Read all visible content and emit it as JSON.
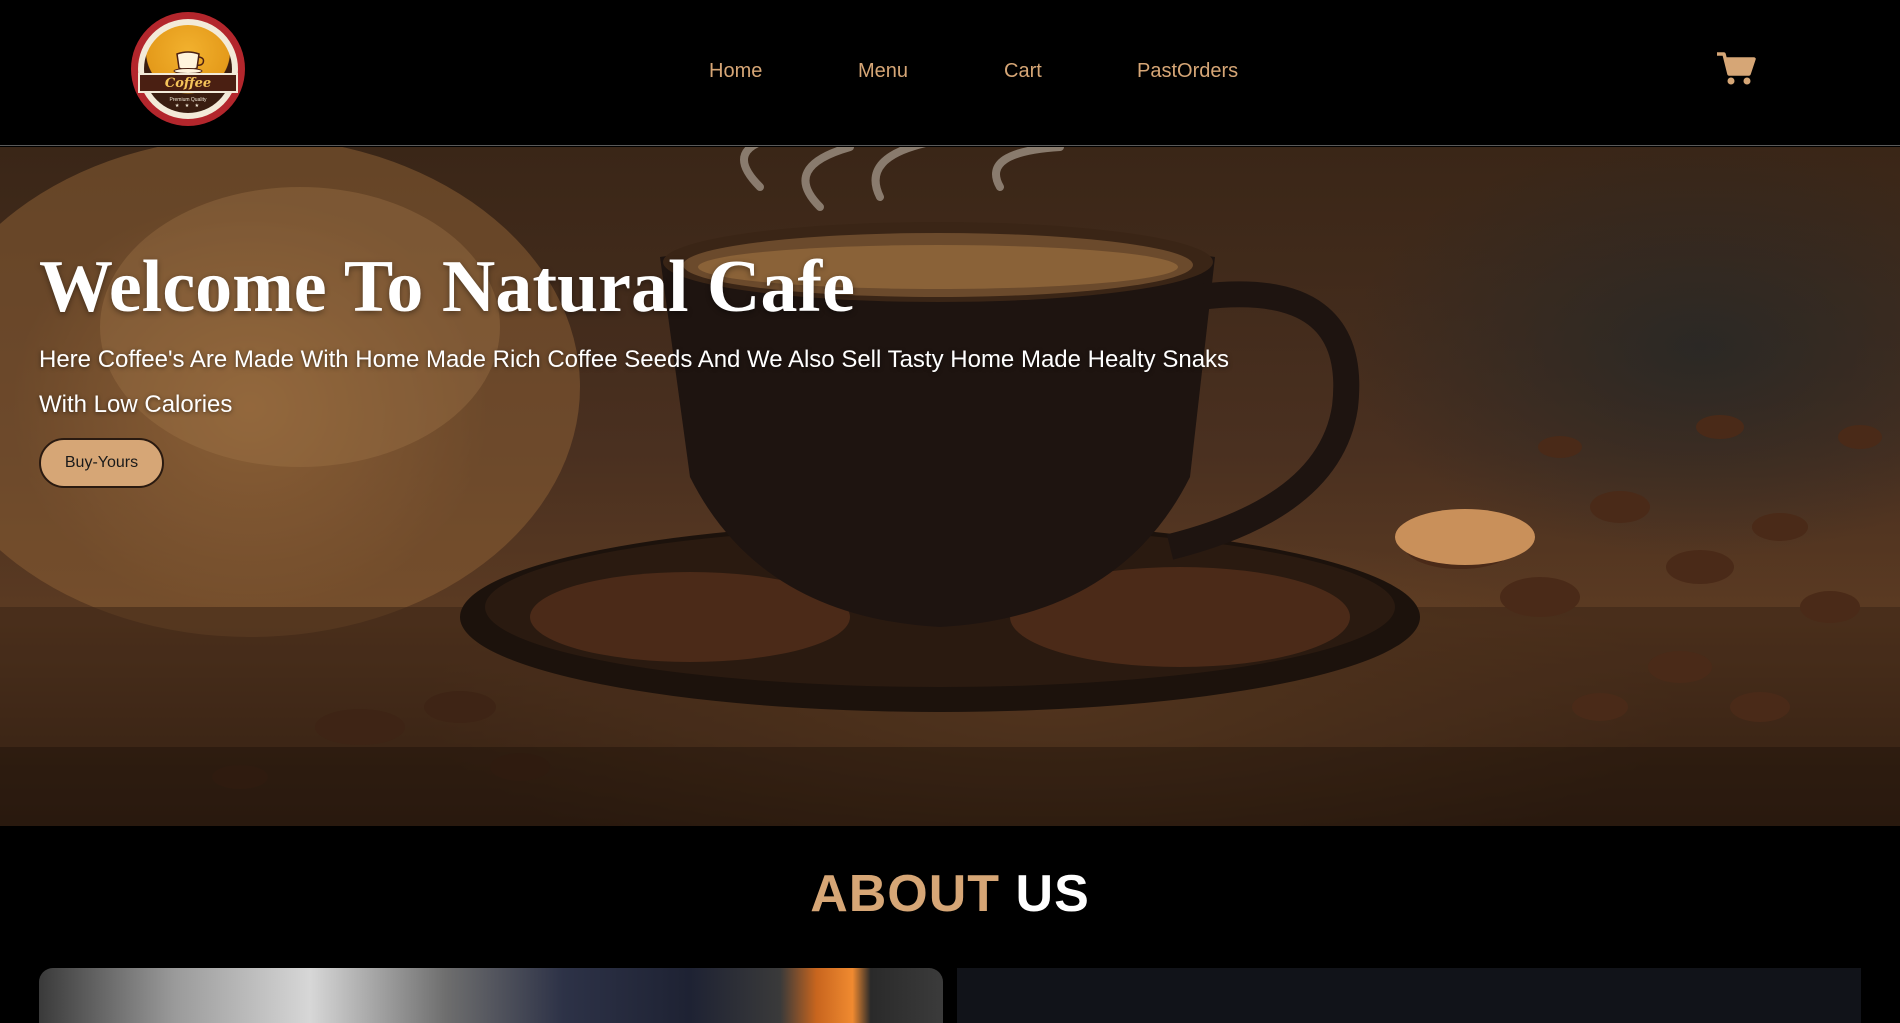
{
  "logo": {
    "banner_text": "Coffee",
    "sub_text": "Premium Quality",
    "stars": "★ ★ ★"
  },
  "nav": {
    "items": [
      {
        "label": "Home"
      },
      {
        "label": "Menu"
      },
      {
        "label": "Cart"
      },
      {
        "label": "PastOrders"
      }
    ],
    "cart_icon": "shopping-cart-icon"
  },
  "hero": {
    "title": "Welcome To Natural Cafe",
    "description": "Here Coffee's Are Made With Home Made Rich Coffee Seeds And We Also Sell Tasty Home Made Healty Snaks With Low Calories",
    "button_label": "Buy-Yours",
    "background_image": "coffee-cup-with-beans"
  },
  "about": {
    "title_part1": "ABOUT",
    "title_part2": "US"
  },
  "colors": {
    "accent": "#d6a676",
    "background": "#000000",
    "text": "#ffffff",
    "panel": "#111319"
  }
}
